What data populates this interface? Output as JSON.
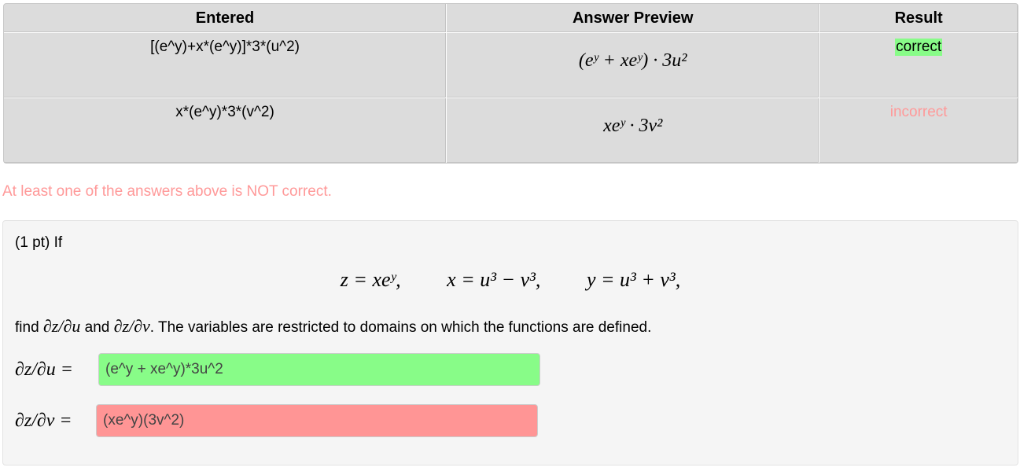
{
  "table": {
    "headers": [
      "Entered",
      "Answer Preview",
      "Result"
    ],
    "rows": [
      {
        "entered": "[(e^y)+x*(e^y)]*3*(u^2)",
        "preview": "(eʸ + xeʸ) · 3u²",
        "result": "correct"
      },
      {
        "entered": "x*(e^y)*3*(v^2)",
        "preview": "xeʸ · 3v²",
        "result": "incorrect"
      }
    ]
  },
  "summary": "At least one of the answers above is NOT correct.",
  "problem": {
    "intro": "(1 pt) If",
    "equations": [
      "z = xeʸ,",
      "x = u³ − v³,",
      "y = u³ + v³,"
    ],
    "find_prefix": "find",
    "find_du": "∂z/∂u",
    "find_and": "and",
    "find_dv": "∂z/∂v",
    "find_suffix": ". The variables are restricted to domains on which the functions are defined.",
    "answers": [
      {
        "label": "∂z/∂u =",
        "value": "(e^y + xe^y)*3u^2",
        "status": "correct"
      },
      {
        "label": "∂z/∂v =",
        "value": "(xe^y)(3v^2)",
        "status": "incorrect"
      }
    ]
  },
  "colors": {
    "correct": "#88fc88",
    "incorrect_bg": "#ff9595",
    "incorrect_text": "#ff9999"
  }
}
